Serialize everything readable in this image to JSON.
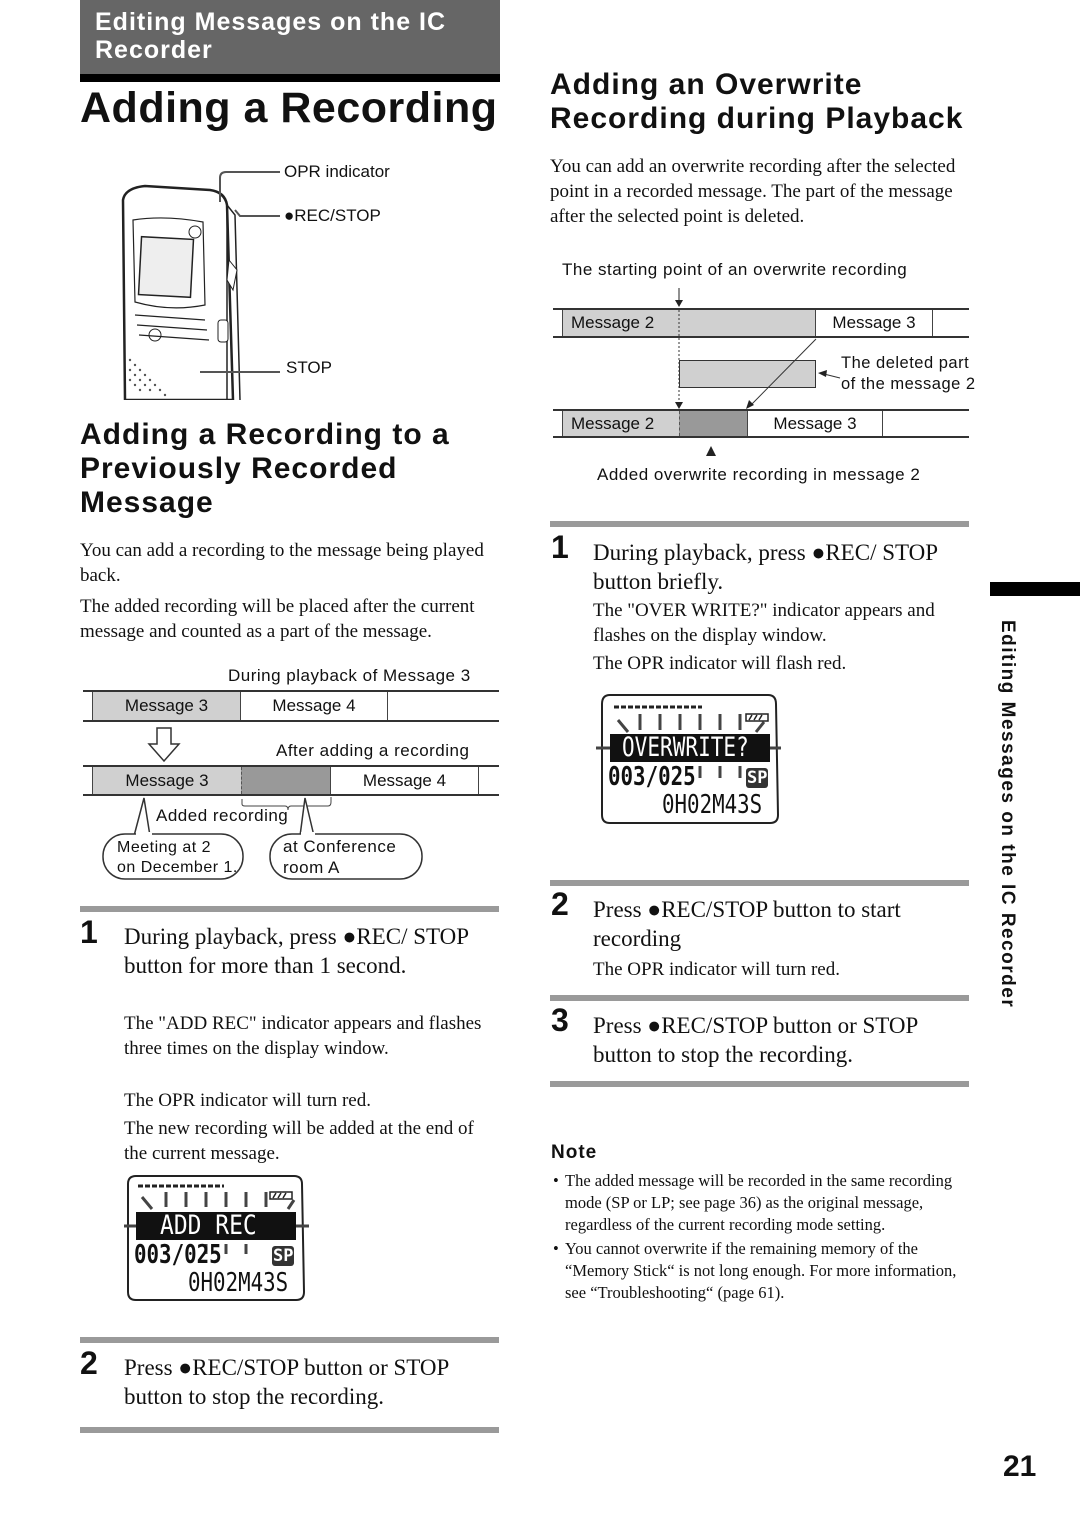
{
  "header": {
    "section_title": "Editing Messages on the IC Recorder",
    "page_title": "Adding a Recording"
  },
  "device_figure": {
    "callouts": [
      "OPR indicator",
      "●REC/STOP",
      "STOP"
    ]
  },
  "left": {
    "heading": "Adding a Recording to a Previously Recorded Message",
    "paragraphs": [
      "You can add a recording to the message being played back.",
      "The added recording will be placed after the current message and counted as a part of the message."
    ],
    "diagram": {
      "top_label": "During playback of Message 3",
      "row1": [
        "Message 3",
        "Message 4"
      ],
      "mid_label": "After adding a recording",
      "row2": [
        "Message 3",
        "",
        "Message 4"
      ],
      "added_label": "Added recording",
      "bubble1": "Meeting at 2 on December 1.",
      "bubble1_lines": [
        "Meeting at 2",
        "on December 1."
      ],
      "bubble2_lines": [
        "at Conference",
        "room A"
      ]
    },
    "steps": [
      {
        "num": "1",
        "text": "During playback, press ●REC/ STOP button for more than 1 second.",
        "subs": [
          "The \"ADD REC\"  indicator appears and flashes three times on the display window.",
          "The OPR indicator will turn red.",
          "The new recording will be added at the end of the current message."
        ]
      },
      {
        "num": "2",
        "text": "Press ●REC/STOP button or STOP button to stop the recording.",
        "subs": []
      }
    ],
    "lcd": {
      "banner": "ADD REC",
      "counter": "003/025",
      "mode": "SP",
      "time": "0H02M43S"
    }
  },
  "right": {
    "heading": "Adding an Overwrite Recording during Playback",
    "paragraph": "You can add an overwrite recording after the selected point in a recorded message. The part of the message after the selected point is deleted.",
    "diagram": {
      "top_label": "The starting point of an overwrite recording",
      "row1": [
        "Message 2",
        "Message 3"
      ],
      "deleted_label_lines": [
        "The deleted part",
        "of the message 2"
      ],
      "row2": [
        "Message 2",
        "Message 3"
      ],
      "bottom_label": "Added overwrite recording in message 2"
    },
    "steps": [
      {
        "num": "1",
        "text": "During playback, press ●REC/ STOP button briefly.",
        "subs": [
          "The \"OVER WRITE?\"  indicator appears and  flashes on the display window.",
          "The OPR indicator will flash red."
        ]
      },
      {
        "num": "2",
        "text": "Press ●REC/STOP button to start recording",
        "subs": [
          "The OPR indicator will turn red."
        ]
      },
      {
        "num": "3",
        "text": "Press ●REC/STOP button or STOP button to stop the recording.",
        "subs": []
      }
    ],
    "lcd": {
      "banner": "OVERWRITE?",
      "counter": "003/025",
      "mode": "SP",
      "time": "0H02M43S"
    },
    "note": {
      "heading": "Note",
      "items": [
        "The added message will be recorded in the same recording mode (SP or LP; see page 36) as the original message, regardless of the current recording mode setting.",
        "You cannot overwrite if the remaining memory of the “Memory Stick“ is not long enough. For more information, see “Troubleshooting“ (page 61)."
      ]
    }
  },
  "side_tab": "Editing Messages on the IC Recorder",
  "page_number": "21",
  "colors": {
    "header_band": "#666666",
    "segment_light": "#d0d0d0",
    "segment_dark": "#999999",
    "step_rule": "#9a9a9a"
  }
}
